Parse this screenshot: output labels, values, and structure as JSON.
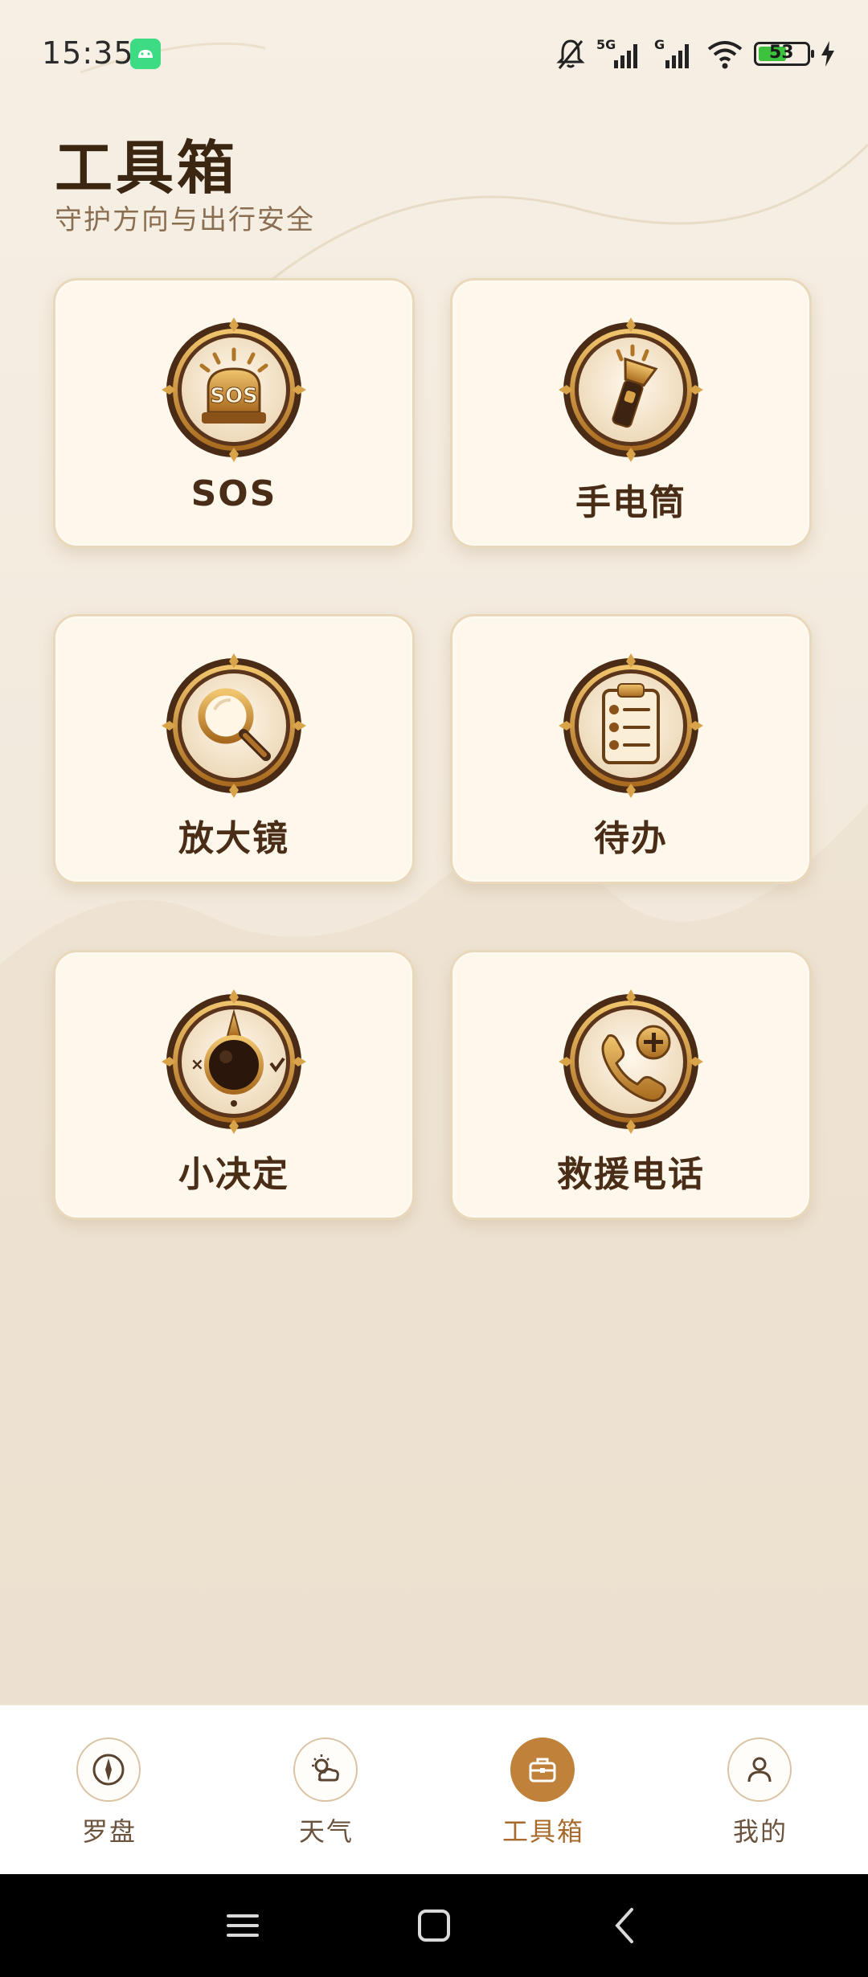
{
  "status_bar": {
    "time": "15:35",
    "battery_level": "53",
    "icons": [
      "android-icon",
      "mute-bell-icon",
      "signal-5g-icon",
      "signal-g-icon",
      "wifi-icon",
      "battery-icon",
      "charging-icon"
    ]
  },
  "header": {
    "title": "工具箱",
    "subtitle": "守护方向与出行安全"
  },
  "tools": [
    {
      "label": "SOS",
      "icon": "sos-siren-icon"
    },
    {
      "label": "手电筒",
      "icon": "flashlight-icon"
    },
    {
      "label": "放大镜",
      "icon": "magnifier-icon"
    },
    {
      "label": "待办",
      "icon": "clipboard-checklist-icon"
    },
    {
      "label": "小决定",
      "icon": "decision-dial-icon"
    },
    {
      "label": "救援电话",
      "icon": "rescue-phone-icon"
    }
  ],
  "sos_badge_text": "SOS",
  "bottom_nav": {
    "active": "工具箱",
    "items": [
      {
        "label": "罗盘",
        "icon": "compass-icon"
      },
      {
        "label": "天气",
        "icon": "weather-icon"
      },
      {
        "label": "工具箱",
        "icon": "toolbox-icon"
      },
      {
        "label": "我的",
        "icon": "user-icon"
      }
    ]
  },
  "colors": {
    "accent": "#c0813a",
    "title": "#3b2612",
    "card_bg": "#fdf7ec",
    "background": "#f2eadd"
  }
}
